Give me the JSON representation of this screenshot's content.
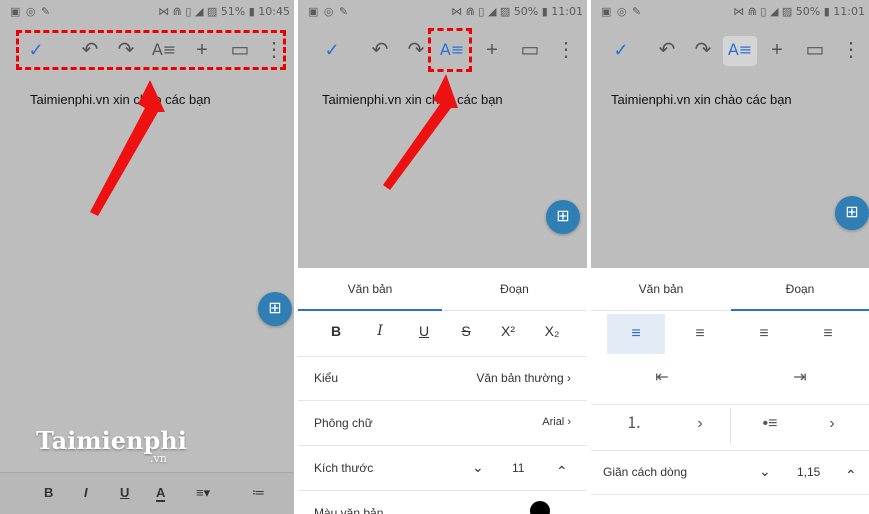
{
  "panel1": {
    "status_left": "▣ ◎ ✎",
    "status_right": "⋈ ⋒ ▯ ◢ ▨ 51% ▮ 10:45",
    "doc_text": "Taimienphi.vn xin chào các bạn",
    "bottom_bar": [
      "B",
      "I",
      "U",
      "A",
      "≡▾",
      "≔"
    ],
    "watermark": "Taimienphi",
    "watermark_sub": ".vn"
  },
  "panel2": {
    "status_left": "▣ ◎ ✎",
    "status_right": "⋈ ⋒ ▯ ◢ ▨ 50% ▮ 11:01",
    "doc_text": "Taimienphi.vn xin chào các bạn",
    "tabs": [
      "Văn bản",
      "Đoạn"
    ],
    "format_buttons": [
      "B",
      "I",
      "U",
      "S",
      "X²",
      "X₂"
    ],
    "rows": [
      {
        "label": "Kiểu",
        "value": "Văn bản thường"
      },
      {
        "label": "Phông chữ",
        "value": "Arial"
      },
      {
        "label": "Kích thước",
        "value": "11"
      },
      {
        "label": "Màu văn bản",
        "value": ""
      }
    ]
  },
  "panel3": {
    "status_left": "▣ ◎ ✎",
    "status_right": "⋈ ⋒ ▯ ◢ ▨ 50% ▮ 11:01",
    "doc_text": "Taimienphi.vn xin chào các bạn",
    "tabs": [
      "Văn bản",
      "Đoạn"
    ],
    "line_spacing_label": "Giãn cách dòng",
    "line_spacing_value": "1,15"
  },
  "icons": {
    "check": "✓",
    "undo": "↶",
    "redo": "↷",
    "format": "A≡",
    "add": "+",
    "comment": "▭",
    "more": "⋮",
    "fab": "⊞",
    "chevron_right": "›",
    "chevron_down": "⌄",
    "chevron_up": "⌃",
    "align_left": "≡",
    "align_center": "≡",
    "align_right": "≡",
    "align_justify": "≡",
    "indent_decrease": "⇤",
    "indent_increase": "⇥",
    "numbered_list": "⒈",
    "bullet_list": "•≡"
  },
  "colors": {
    "accent": "#2b6fd6",
    "highlight": "#ff0000",
    "fab": "#2f7fb4",
    "doc_bg": "#bdbdbd"
  }
}
